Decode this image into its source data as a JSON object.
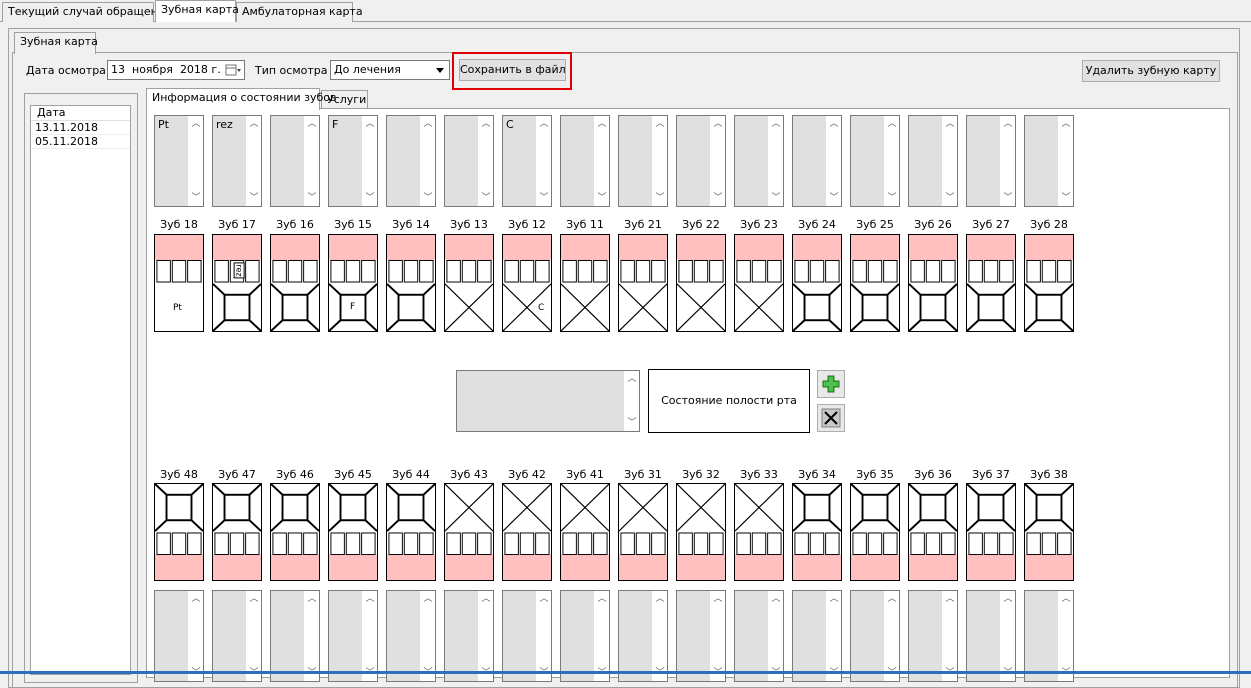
{
  "top_tabs": [
    "Текущий случай обращения",
    "Зубная карта",
    "Амбулаторная карта"
  ],
  "inner_tab": "Зубная карта",
  "form": {
    "date_label": "Дата осмотра",
    "date_day": "13",
    "date_month": "ноября",
    "date_year": "2018 г.",
    "type_label": "Тип осмотра",
    "type_value": "До лечения",
    "save_button": "Сохранить в файл",
    "delete_button": "Удалить зубную карту"
  },
  "history": {
    "header": "Дата",
    "dates": [
      "13.11.2018",
      "05.11.2018"
    ]
  },
  "sub_tabs": [
    "Информация о состоянии зубов",
    "Услуги"
  ],
  "upper_teeth": [
    {
      "label": "Зуб 18",
      "note": "Pt",
      "mark": "Pt",
      "crossed": false,
      "absent": true
    },
    {
      "label": "Зуб 17",
      "note": "rez",
      "mark": "rez",
      "crossed": false,
      "absent": false
    },
    {
      "label": "Зуб 16",
      "note": "",
      "mark": "",
      "crossed": false,
      "absent": false
    },
    {
      "label": "Зуб 15",
      "note": "F",
      "mark": "F",
      "crossed": false,
      "absent": false
    },
    {
      "label": "Зуб 14",
      "note": "",
      "mark": "",
      "crossed": false,
      "absent": false
    },
    {
      "label": "Зуб 13",
      "note": "",
      "mark": "",
      "crossed": true,
      "absent": false
    },
    {
      "label": "Зуб 12",
      "note": "C",
      "mark": "C",
      "crossed": true,
      "absent": false
    },
    {
      "label": "Зуб 11",
      "note": "",
      "mark": "",
      "crossed": true,
      "absent": false
    },
    {
      "label": "Зуб 21",
      "note": "",
      "mark": "",
      "crossed": true,
      "absent": false
    },
    {
      "label": "Зуб 22",
      "note": "",
      "mark": "",
      "crossed": true,
      "absent": false
    },
    {
      "label": "Зуб 23",
      "note": "",
      "mark": "",
      "crossed": true,
      "absent": false
    },
    {
      "label": "Зуб 24",
      "note": "",
      "mark": "",
      "crossed": false,
      "absent": false
    },
    {
      "label": "Зуб 25",
      "note": "",
      "mark": "",
      "crossed": false,
      "absent": false
    },
    {
      "label": "Зуб 26",
      "note": "",
      "mark": "",
      "crossed": false,
      "absent": false
    },
    {
      "label": "Зуб 27",
      "note": "",
      "mark": "",
      "crossed": false,
      "absent": false
    },
    {
      "label": "Зуб 28",
      "note": "",
      "mark": "",
      "crossed": false,
      "absent": false
    }
  ],
  "lower_teeth": [
    {
      "label": "Зуб 48",
      "crossed": false
    },
    {
      "label": "Зуб 47",
      "crossed": false
    },
    {
      "label": "Зуб 46",
      "crossed": false
    },
    {
      "label": "Зуб 45",
      "crossed": false
    },
    {
      "label": "Зуб 44",
      "crossed": false
    },
    {
      "label": "Зуб 43",
      "crossed": true
    },
    {
      "label": "Зуб 42",
      "crossed": true
    },
    {
      "label": "Зуб 41",
      "crossed": true
    },
    {
      "label": "Зуб 31",
      "crossed": true
    },
    {
      "label": "Зуб 32",
      "crossed": true
    },
    {
      "label": "Зуб 33",
      "crossed": true
    },
    {
      "label": "Зуб 34",
      "crossed": false
    },
    {
      "label": "Зуб 35",
      "crossed": false
    },
    {
      "label": "Зуб 36",
      "crossed": false
    },
    {
      "label": "Зуб 37",
      "crossed": false
    },
    {
      "label": "Зуб 38",
      "crossed": false
    }
  ],
  "oral_state": "Состояние полости рта",
  "colors": {
    "gum": "#ffc0c0",
    "highlight": "#e00000"
  },
  "icons": {
    "add": "plus-icon",
    "delete": "close-icon",
    "calendar": "calendar-icon",
    "dropdown": "chevron-down-icon"
  }
}
